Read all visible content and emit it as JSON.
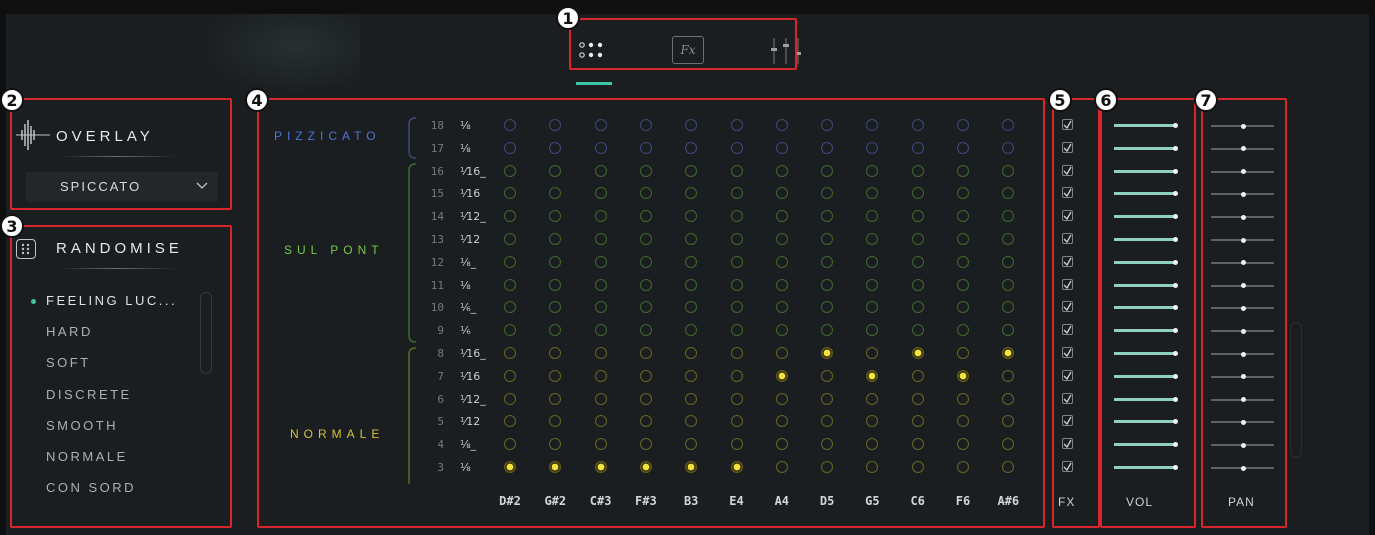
{
  "callouts": [
    "1",
    "2",
    "3",
    "4",
    "5",
    "6",
    "7"
  ],
  "topbar": {
    "icons": [
      "grid-dots-icon",
      "fx-icon",
      "sliders-icon"
    ],
    "active": "grid-dots-icon",
    "fx_label": "Fx"
  },
  "overlay": {
    "title": "OVERLAY",
    "select_value": "SPICCATO"
  },
  "randomise": {
    "title": "RANDOMISE",
    "items": [
      "FEELING LUC...",
      "HARD",
      "SOFT",
      "DISCRETE",
      "SMOOTH",
      "NORMALE",
      "CON SORD"
    ],
    "selected": "FEELING LUC..."
  },
  "grid": {
    "articulations": [
      {
        "name": "PIZZICATO",
        "color": "#4f73d8"
      },
      {
        "name": "SUL PONT",
        "color": "#74c94a"
      },
      {
        "name": "NORMALE",
        "color": "#d6c13a"
      }
    ],
    "rows": [
      {
        "num": "18",
        "frac": "⅛"
      },
      {
        "num": "17",
        "frac": "⅛"
      },
      {
        "num": "16",
        "frac": "⅟16_"
      },
      {
        "num": "15",
        "frac": "⅟16"
      },
      {
        "num": "14",
        "frac": "⅟12_"
      },
      {
        "num": "13",
        "frac": "⅟12"
      },
      {
        "num": "12",
        "frac": "⅛_"
      },
      {
        "num": "11",
        "frac": "⅛"
      },
      {
        "num": "10",
        "frac": "⅙_"
      },
      {
        "num": "9",
        "frac": "⅙"
      },
      {
        "num": "8",
        "frac": "⅟16_"
      },
      {
        "num": "7",
        "frac": "⅟16"
      },
      {
        "num": "6",
        "frac": "⅟12_"
      },
      {
        "num": "5",
        "frac": "⅟12"
      },
      {
        "num": "4",
        "frac": "⅛_"
      },
      {
        "num": "3",
        "frac": "⅛"
      }
    ],
    "columns": [
      "D#2",
      "G#2",
      "C#3",
      "F#3",
      "B3",
      "E4",
      "A4",
      "D5",
      "G5",
      "C6",
      "F6",
      "A#6"
    ],
    "active_cells": [
      [
        15,
        0
      ],
      [
        15,
        1
      ],
      [
        15,
        2
      ],
      [
        15,
        3
      ],
      [
        15,
        4
      ],
      [
        15,
        5
      ],
      [
        11,
        6
      ],
      [
        10,
        7
      ],
      [
        11,
        8
      ],
      [
        10,
        9
      ],
      [
        11,
        10
      ],
      [
        10,
        11
      ]
    ]
  },
  "fx": {
    "label": "FX",
    "checked": true
  },
  "vol": {
    "label": "VOL",
    "level": 1.0
  },
  "pan": {
    "label": "PAN",
    "position": 0.5
  },
  "colors": {
    "pizz": "#3b4a7a",
    "sul": "#3f6a2c",
    "norm": "#6a6424",
    "active": "#f5e23a",
    "accent": "#3fc6a4",
    "red": "#d8262c"
  }
}
